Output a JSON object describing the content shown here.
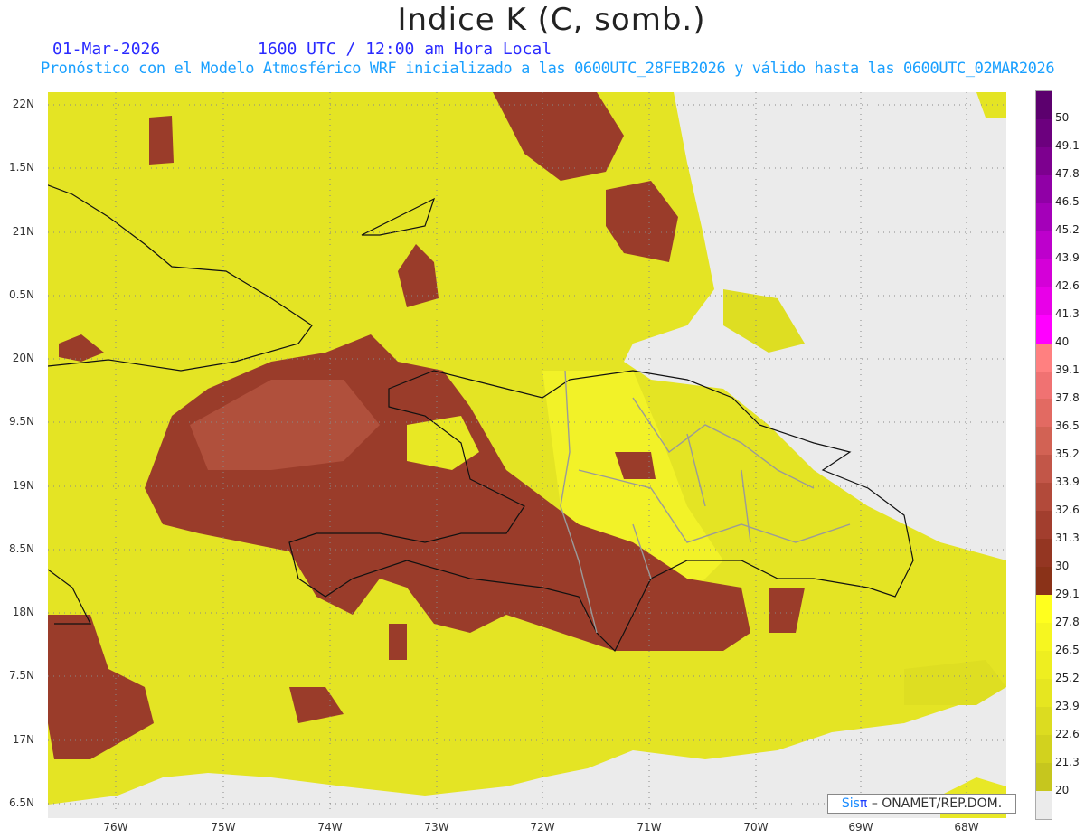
{
  "title": "Indice K (C, somb.)",
  "date": "01-Mar-2026",
  "time": "1600 UTC / 12:00 am Hora Local",
  "subtitle": "Pronóstico con el Modelo Atmosférico WRF inicializado a las 0600UTC_28FEB2026 y válido hasta las  0600UTC_02MAR2026",
  "lat_labels": [
    "22N",
    "1.5N",
    "21N",
    "0.5N",
    "20N",
    "9.5N",
    "19N",
    "8.5N",
    "18N",
    "7.5N",
    "17N",
    "6.5N"
  ],
  "lon_labels": [
    "76W",
    "75W",
    "74W",
    "73W",
    "72W",
    "71W",
    "70W",
    "69W",
    "68W"
  ],
  "colorbar": {
    "labels": [
      "50",
      "49.1",
      "47.8",
      "46.5",
      "45.2",
      "43.9",
      "42.6",
      "41.3",
      "40",
      "39.1",
      "37.8",
      "36.5",
      "35.2",
      "33.9",
      "32.6",
      "31.3",
      "30",
      "29.1",
      "27.8",
      "26.5",
      "25.2",
      "23.9",
      "22.6",
      "21.3",
      "20"
    ],
    "colors": [
      "#5c006e",
      "#6c007e",
      "#7d008f",
      "#9000a6",
      "#a400b9",
      "#bd00cc",
      "#d400d8",
      "#e800e8",
      "#ff00ff",
      "#ff8080",
      "#f07272",
      "#e26a62",
      "#d26254",
      "#c25648",
      "#b24a3a",
      "#a23e2e",
      "#943622",
      "#8a3218",
      "#ffff1e",
      "#f6f620",
      "#eeee20",
      "#e6e620",
      "#dcdc20",
      "#d2d21e",
      "#c6c61e",
      "#ebebeb"
    ]
  },
  "fill_colors": {
    "background": "#ebebeb",
    "yellow": "#e6e622",
    "brown": "#9a3c2a",
    "brown_light": "#b0503c"
  },
  "credit": {
    "sis": "Sis",
    "pi": "π",
    "rest": "– ONAMET/REP.DOM."
  }
}
